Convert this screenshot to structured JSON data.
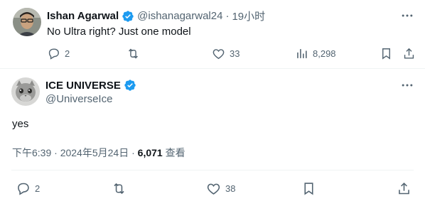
{
  "colors": {
    "text": "#0f1419",
    "secondary": "#536471",
    "verified": "#1d9bf0",
    "divider": "#eff3f4"
  },
  "reply_tweet": {
    "author_name": "Ishan Agarwal",
    "author_handle": "@ishanagarwal24",
    "separator": "·",
    "time_ago": "19小时",
    "text": "No Ultra right? Just one model",
    "actions": {
      "reply_count": "2",
      "retweet_count": "",
      "like_count": "33",
      "view_count": "8,298"
    }
  },
  "main_tweet": {
    "author_name": "ICE UNIVERSE",
    "author_handle": "@UniverseIce",
    "text": "yes",
    "timestamp": "下午6:39 · 2024年5月24日",
    "meta_separator": "·",
    "view_count": "6,071",
    "view_label": "查看",
    "actions": {
      "reply_count": "2",
      "retweet_count": "",
      "like_count": "38"
    }
  },
  "icons": [
    "verified-badge-icon",
    "more-icon",
    "reply-icon",
    "retweet-icon",
    "like-icon",
    "views-icon",
    "bookmark-icon",
    "share-icon"
  ]
}
